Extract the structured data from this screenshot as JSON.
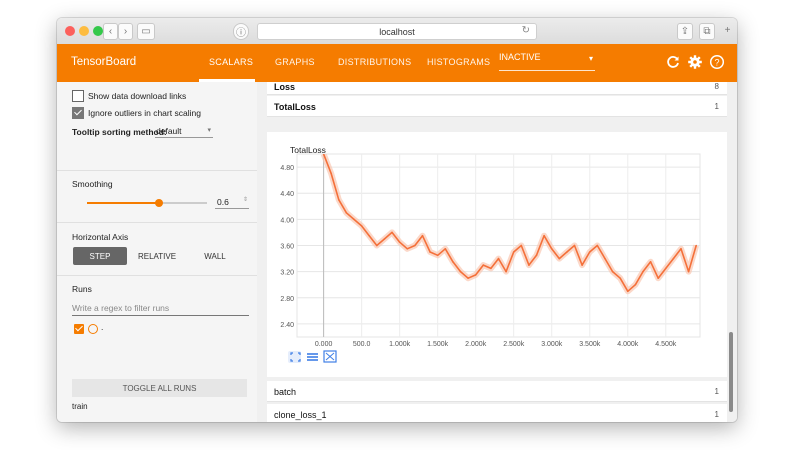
{
  "browser": {
    "address": "localhost",
    "info_icon": "info-icon",
    "reload_icon": "reload-icon"
  },
  "app": {
    "brand": "TensorBoard",
    "tabs": [
      "SCALARS",
      "GRAPHS",
      "DISTRIBUTIONS",
      "HISTOGRAMS"
    ],
    "active_tab": "SCALARS",
    "dropdown_value": "INACTIVE",
    "accent": "#f57c00"
  },
  "sidebar": {
    "show_download": {
      "label": "Show data download links",
      "checked": false
    },
    "ignore_outliers": {
      "label": "Ignore outliers in chart scaling",
      "checked": true
    },
    "tooltip_label": "Tooltip sorting method:",
    "tooltip_value": "default",
    "smoothing_label": "Smoothing",
    "smoothing_value": "0.6",
    "horizontal_axis_label": "Horizontal Axis",
    "axis_options": [
      "STEP",
      "RELATIVE",
      "WALL"
    ],
    "axis_active": "STEP",
    "runs_label": "Runs",
    "runs_filter_placeholder": "Write a regex to filter runs",
    "run_name": ".",
    "toggle_all": "TOGGLE ALL RUNS",
    "footer": "train"
  },
  "main": {
    "loss_card": {
      "title": "Loss",
      "count": "8"
    },
    "totalloss_card": {
      "title": "TotalLoss",
      "count": "1"
    },
    "batch_card": {
      "title": "batch",
      "count": "1"
    },
    "clone_card": {
      "title": "clone_loss_1",
      "count": "1"
    }
  },
  "chart_data": {
    "type": "line",
    "title": "TotalLoss",
    "xlabel": "",
    "ylabel": "",
    "x_ticks": [
      "0.000",
      "500.0",
      "1.000k",
      "1.500k",
      "2.000k",
      "2.500k",
      "3.000k",
      "3.500k",
      "4.000k",
      "4.500k"
    ],
    "y_ticks": [
      "2.40",
      "2.80",
      "3.20",
      "3.60",
      "4.00",
      "4.40",
      "4.80"
    ],
    "xlim": [
      -350,
      4950
    ],
    "ylim": [
      2.2,
      5.0
    ],
    "series": [
      {
        "color": "#f4703a",
        "x": [
          0,
          100,
          200,
          300,
          400,
          500,
          600,
          700,
          800,
          900,
          1000,
          1100,
          1200,
          1300,
          1400,
          1500,
          1600,
          1700,
          1800,
          1900,
          2000,
          2100,
          2200,
          2300,
          2400,
          2500,
          2600,
          2700,
          2800,
          2900,
          3000,
          3100,
          3200,
          3300,
          3400,
          3500,
          3600,
          3700,
          3800,
          3900,
          4000,
          4100,
          4200,
          4300,
          4400,
          4500,
          4600,
          4700,
          4800,
          4900
        ],
        "y": [
          5.0,
          4.7,
          4.3,
          4.1,
          4.0,
          3.9,
          3.75,
          3.6,
          3.7,
          3.8,
          3.65,
          3.55,
          3.6,
          3.75,
          3.5,
          3.45,
          3.55,
          3.35,
          3.2,
          3.1,
          3.15,
          3.3,
          3.25,
          3.4,
          3.2,
          3.5,
          3.6,
          3.3,
          3.45,
          3.75,
          3.55,
          3.4,
          3.5,
          3.6,
          3.3,
          3.5,
          3.6,
          3.4,
          3.2,
          3.1,
          2.9,
          3.0,
          3.2,
          3.35,
          3.1,
          3.25,
          3.4,
          3.55,
          3.2,
          3.6
        ]
      }
    ],
    "grid": true
  }
}
